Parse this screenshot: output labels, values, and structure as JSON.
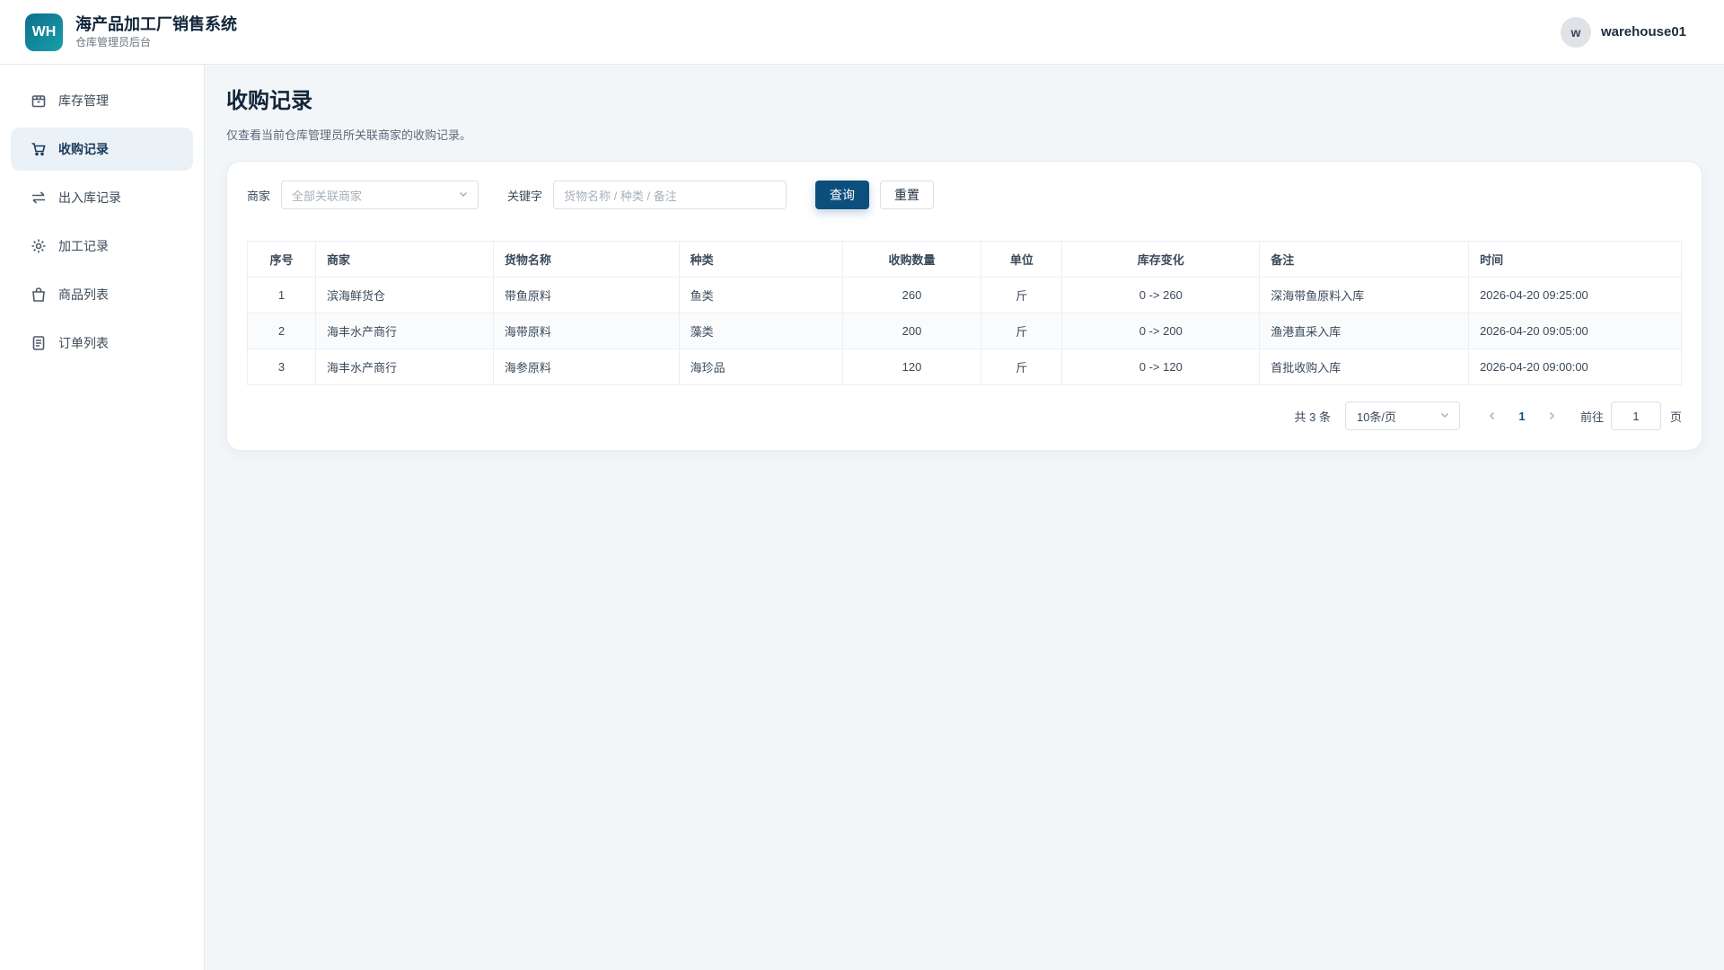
{
  "header": {
    "logo_text": "WH",
    "title": "海产品加工厂销售系统",
    "subtitle": "仓库管理员后台",
    "avatar_letter": "w",
    "username": "warehouse01"
  },
  "sidebar": {
    "items": [
      {
        "label": "库存管理",
        "icon": "box-icon",
        "active": false
      },
      {
        "label": "收购记录",
        "icon": "cart-icon",
        "active": true
      },
      {
        "label": "出入库记录",
        "icon": "transfer-icon",
        "active": false
      },
      {
        "label": "加工记录",
        "icon": "gear-icon",
        "active": false
      },
      {
        "label": "商品列表",
        "icon": "bag-icon",
        "active": false
      },
      {
        "label": "订单列表",
        "icon": "document-icon",
        "active": false
      }
    ]
  },
  "page": {
    "title": "收购记录",
    "description": "仅查看当前仓库管理员所关联商家的收购记录。"
  },
  "filters": {
    "merchant_label": "商家",
    "merchant_placeholder": "全部关联商家",
    "keyword_label": "关键字",
    "keyword_placeholder": "货物名称 / 种类 / 备注",
    "search_button": "查询",
    "reset_button": "重置"
  },
  "table": {
    "columns": [
      "序号",
      "商家",
      "货物名称",
      "种类",
      "收购数量",
      "单位",
      "库存变化",
      "备注",
      "时间"
    ],
    "rows": [
      [
        "1",
        "滨海鲜货仓",
        "带鱼原料",
        "鱼类",
        "260",
        "斤",
        "0 -> 260",
        "深海带鱼原料入库",
        "2026-04-20 09:25:00"
      ],
      [
        "2",
        "海丰水产商行",
        "海带原料",
        "藻类",
        "200",
        "斤",
        "0 -> 200",
        "渔港直采入库",
        "2026-04-20 09:05:00"
      ],
      [
        "3",
        "海丰水产商行",
        "海参原料",
        "海珍品",
        "120",
        "斤",
        "0 -> 120",
        "首批收购入库",
        "2026-04-20 09:00:00"
      ]
    ]
  },
  "pagination": {
    "total": "共 3 条",
    "page_size": "10条/页",
    "current_page": "1",
    "goto_label": "前往",
    "goto_value": "1",
    "page_suffix": "页"
  },
  "colors": {
    "primary": "#0d4f7c",
    "active_nav_bg": "#eaf2f8",
    "background": "#f3f6f9"
  }
}
